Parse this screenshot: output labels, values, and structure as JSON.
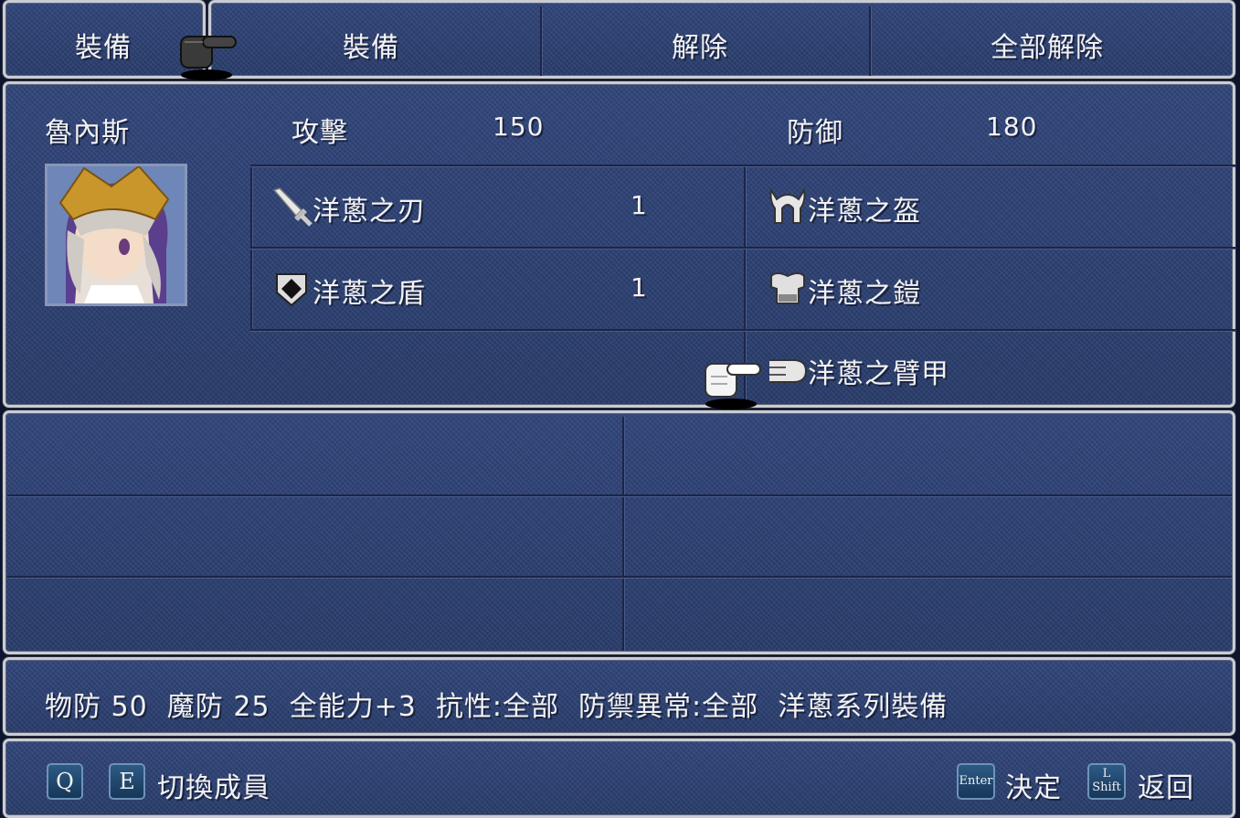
{
  "menu": {
    "left_label": "裝備",
    "commands": [
      "裝備",
      "解除",
      "全部解除"
    ]
  },
  "character": {
    "name": "魯內斯",
    "attack_label": "攻擊",
    "attack_value": "150",
    "defense_label": "防御",
    "defense_value": "180"
  },
  "equipment": {
    "weapon": {
      "icon": "sword-icon",
      "name": "洋蔥之刃",
      "qty": "1"
    },
    "shield": {
      "icon": "shield-icon",
      "name": "洋蔥之盾",
      "qty": "1"
    },
    "head": {
      "icon": "helmet-icon",
      "name": "洋蔥之盔"
    },
    "body": {
      "icon": "armor-icon",
      "name": "洋蔥之鎧"
    },
    "arms": {
      "icon": "gauntlet-icon",
      "name": "洋蔥之臂甲"
    }
  },
  "description": "物防 50  魔防 25  全能力+3  抗性:全部  防禦異常:全部  洋蔥系列裝備",
  "footer": {
    "key_q": "Q",
    "key_e": "E",
    "switch_label": "切換成員",
    "key_enter": "Enter",
    "confirm_label": "決定",
    "key_shift_top": "L",
    "key_shift_bottom": "Shift",
    "back_label": "返回"
  },
  "colors": {
    "panel_bg": "#2b3e6e",
    "panel_border": "#c9ccd4",
    "text": "#f2f2f2"
  }
}
